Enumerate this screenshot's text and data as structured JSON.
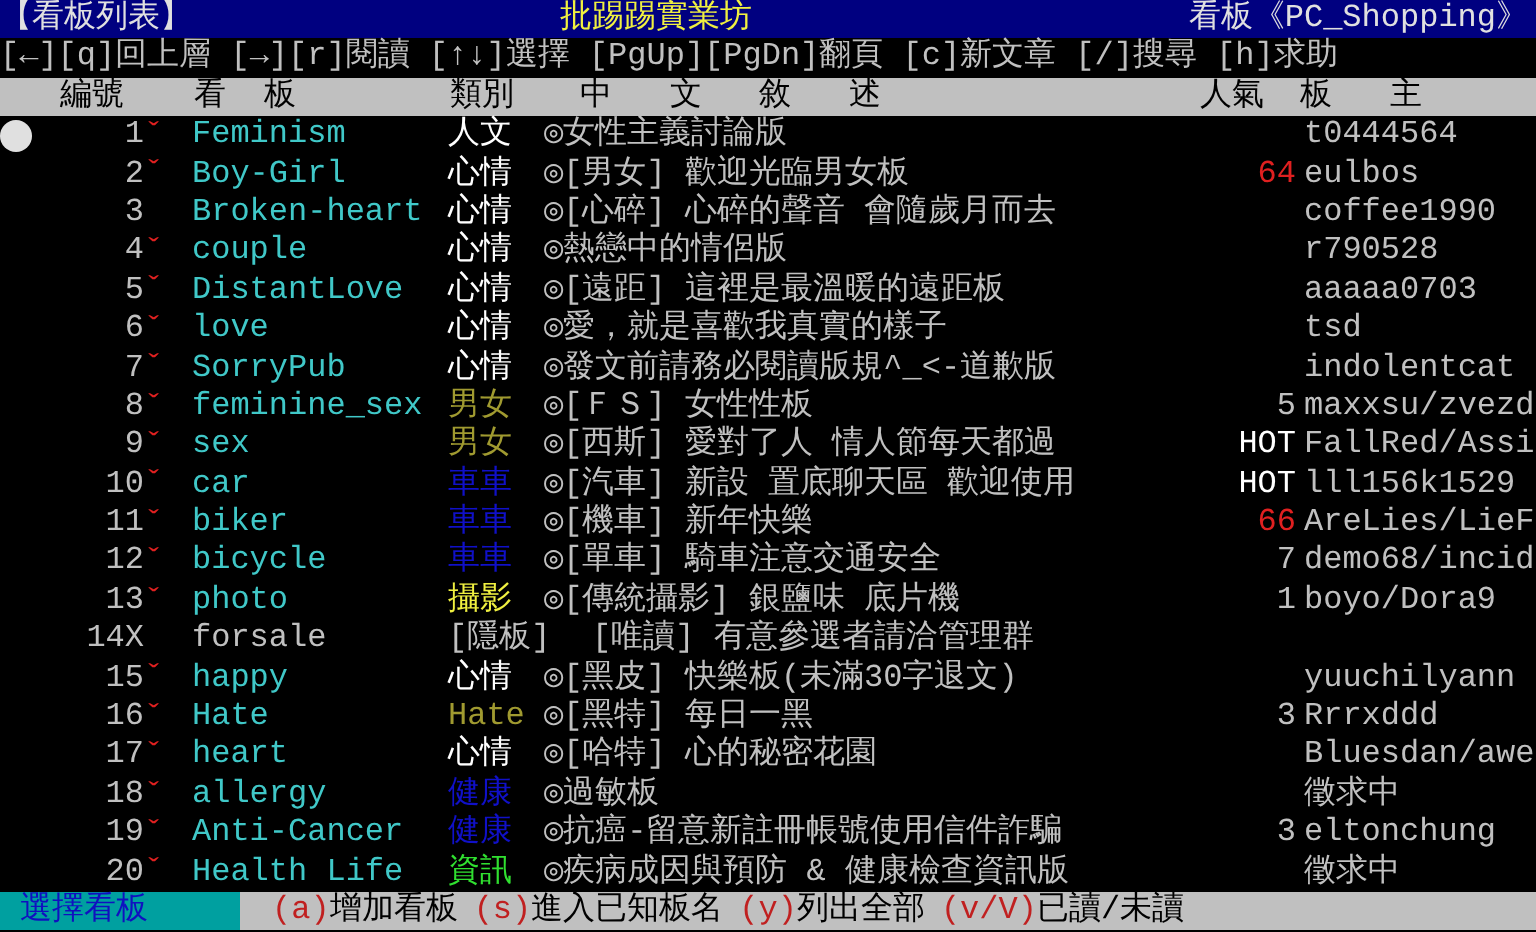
{
  "header": {
    "left": "【看板列表】",
    "center": "批踢踢實業坊",
    "right": "看板《PC_Shopping》"
  },
  "help_line": "[←][q]回上層 [→][r]閱讀 [↑↓]選擇 [PgUp][PgDn]翻頁 [c]新文章 [/]搜尋 [h]求助",
  "columns": [
    "編號",
    "看  板",
    "類別",
    "中   文   敘   述",
    "人氣",
    "板   主"
  ],
  "rows": [
    {
      "kind": "board",
      "selected": true,
      "number": "1",
      "mark": "ˇ",
      "name": "Feminism",
      "category": {
        "text": "人文",
        "color": "#ffffff"
      },
      "description": "◎女性主義討論版",
      "moderator": "t0444564"
    },
    {
      "kind": "board",
      "selected": false,
      "number": "2",
      "mark": "ˇ",
      "name": "Boy-Girl",
      "category": {
        "text": "心情",
        "color": "#ffffff"
      },
      "description": "◎[男女] 歡迎光臨男女板",
      "popularity": {
        "text": "64",
        "color": "#e02020"
      },
      "moderator": "eulbos"
    },
    {
      "kind": "board",
      "selected": false,
      "number": "3",
      "name": "Broken-heart",
      "category": {
        "text": "心情",
        "color": "#ffffff"
      },
      "description": "◎[心碎] 心碎的聲音 會隨歲月而去",
      "moderator": "coffee1990"
    },
    {
      "kind": "board",
      "selected": false,
      "number": "4",
      "mark": "ˇ",
      "name": "couple",
      "category": {
        "text": "心情",
        "color": "#ffffff"
      },
      "description": "◎熱戀中的情侶版",
      "moderator": "r790528"
    },
    {
      "kind": "board",
      "selected": false,
      "number": "5",
      "mark": "ˇ",
      "name": "DistantLove",
      "category": {
        "text": "心情",
        "color": "#ffffff"
      },
      "description": "◎[遠距] 這裡是最溫暖的遠距板",
      "moderator": "aaaaa0703"
    },
    {
      "kind": "board",
      "selected": false,
      "number": "6",
      "mark": "ˇ",
      "name": "love",
      "category": {
        "text": "心情",
        "color": "#ffffff"
      },
      "description": "◎愛，就是喜歡我真實的樣子",
      "moderator": "tsd"
    },
    {
      "kind": "board",
      "selected": false,
      "number": "7",
      "mark": "ˇ",
      "name": "SorryPub",
      "category": {
        "text": "心情",
        "color": "#ffffff"
      },
      "description": "◎發文前請務必閱讀版規^_<-道歉版",
      "moderator": "indolentcat"
    },
    {
      "kind": "board",
      "selected": false,
      "number": "8",
      "mark": "ˇ",
      "name": "feminine_sex",
      "category": {
        "text": "男女",
        "color": "#a09a30"
      },
      "description": "◎[ＦＳ] 女性性板",
      "popularity": {
        "text": "5",
        "color": "#c0c0c0"
      },
      "moderator": "maxxsu/zvezd"
    },
    {
      "kind": "board",
      "selected": false,
      "number": "9",
      "mark": "ˇ",
      "name": "sex",
      "category": {
        "text": "男女",
        "color": "#a09a30"
      },
      "description": "◎[西斯] 愛對了人 情人節每天都過",
      "popularity": {
        "text": "HOT",
        "color": "#ffffff"
      },
      "moderator": "FallRed/Assi"
    },
    {
      "kind": "board",
      "selected": false,
      "number": "10",
      "mark": "ˇ",
      "name": "car",
      "category": {
        "text": "車車",
        "color": "#1010c8"
      },
      "description": "◎[汽車] 新設 置底聊天區 歡迎使用",
      "popularity": {
        "text": "HOT",
        "color": "#ffffff"
      },
      "moderator": "lll156k1529"
    },
    {
      "kind": "board",
      "selected": false,
      "number": "11",
      "mark": "ˇ",
      "name": "biker",
      "category": {
        "text": "車車",
        "color": "#1010c8"
      },
      "description": "◎[機車] 新年快樂",
      "popularity": {
        "text": "66",
        "color": "#e02020"
      },
      "moderator": "AreLies/LieF"
    },
    {
      "kind": "board",
      "selected": false,
      "number": "12",
      "mark": "ˇ",
      "name": "bicycle",
      "category": {
        "text": "車車",
        "color": "#1010c8"
      },
      "description": "◎[單車] 騎車注意交通安全",
      "popularity": {
        "text": "7",
        "color": "#c0c0c0"
      },
      "moderator": "demo68/incid"
    },
    {
      "kind": "board",
      "selected": false,
      "number": "13",
      "mark": "ˇ",
      "name": "photo",
      "category": {
        "text": "攝影",
        "color": "#f0f040"
      },
      "description": "◎[傳統攝影] 銀鹽味 底片機",
      "popularity": {
        "text": "1",
        "color": "#c0c0c0"
      },
      "moderator": "boyo/Dora9"
    },
    {
      "kind": "hidden",
      "selected": false,
      "number": "14X",
      "name": "forsale",
      "category": {
        "text": "[隱板]",
        "color": "#c0c0c0"
      },
      "description": "[唯讀] 有意參選者請洽管理群"
    },
    {
      "kind": "board",
      "selected": false,
      "number": "15",
      "mark": "ˇ",
      "name": "happy",
      "category": {
        "text": "心情",
        "color": "#ffffff"
      },
      "description": "◎[黑皮] 快樂板(未滿30字退文)",
      "moderator": "yuuchilyann"
    },
    {
      "kind": "board",
      "selected": false,
      "number": "16",
      "mark": "ˇ",
      "name": "Hate",
      "category": {
        "text": "Hate",
        "color": "#a09a30"
      },
      "description": "◎[黑特] 每日一黑",
      "popularity": {
        "text": "3",
        "color": "#c0c0c0"
      },
      "moderator": "Rrrxddd"
    },
    {
      "kind": "board",
      "selected": false,
      "number": "17",
      "mark": "ˇ",
      "name": "heart",
      "category": {
        "text": "心情",
        "color": "#ffffff"
      },
      "description": "◎[哈特] 心的秘密花園",
      "moderator": "Bluesdan/awe"
    },
    {
      "kind": "board",
      "selected": false,
      "number": "18",
      "mark": "ˇ",
      "name": "allergy",
      "category": {
        "text": "健康",
        "color": "#1010c8"
      },
      "description": "◎過敏板",
      "moderator": "徵求中"
    },
    {
      "kind": "board",
      "selected": false,
      "number": "19",
      "mark": "ˇ",
      "name": "Anti-Cancer",
      "category": {
        "text": "健康",
        "color": "#1010c8"
      },
      "description": "◎抗癌-留意新註冊帳號使用信件詐騙",
      "popularity": {
        "text": "3",
        "color": "#c0c0c0"
      },
      "moderator": "eltonchung"
    },
    {
      "kind": "board",
      "selected": false,
      "number": "20",
      "mark": "ˇ",
      "name": "Health Life",
      "category": {
        "text": "資訊",
        "color": "#30e030"
      },
      "description": "◎疾病成因與預防 & 健康檢查資訊版",
      "moderator": "徵求中"
    }
  ],
  "footer": {
    "title": "選擇看板",
    "commands": [
      {
        "key": "(a)",
        "label": "增加看板"
      },
      {
        "key": "(s)",
        "label": "進入已知板名"
      },
      {
        "key": "(y)",
        "label": "列出全部"
      },
      {
        "key": "(v/V)",
        "label": "已讀/未讀"
      }
    ]
  }
}
